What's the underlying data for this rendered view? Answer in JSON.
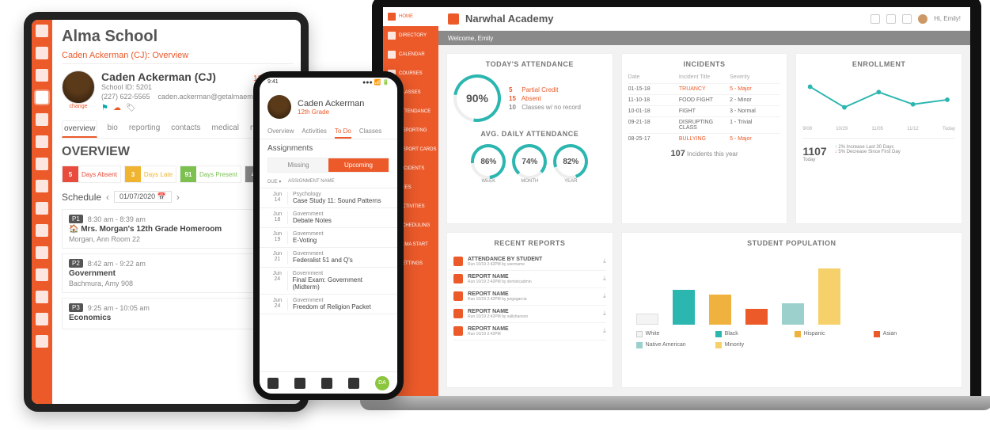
{
  "tablet": {
    "title": "Alma School",
    "breadcrumb": "Caden Ackerman (CJ): Overview",
    "change_label": "change",
    "student": {
      "name": "Caden Ackerman (CJ)",
      "id_label": "School ID: 5201",
      "grade": "12th Grade",
      "phone": "(227) 622-5565",
      "email": "caden.ackerman@getalmaemail.com"
    },
    "tabs": [
      "overview",
      "bio",
      "reporting",
      "contacts",
      "medical",
      "notes"
    ],
    "overview_heading": "OVERVIEW",
    "badges": {
      "absent_n": "5",
      "absent_l": "Days Absent",
      "late_n": "3",
      "late_l": "Days Late",
      "present_n": "91",
      "present_l": "Days Present",
      "other_n": "4",
      "other_l": "Days"
    },
    "schedule_label": "Schedule",
    "schedule_date": "01/07/2020",
    "slots": [
      {
        "pill": "P1",
        "time": "8:30 am - 8:39 am",
        "title": "🏠 Mrs. Morgan's 12th Grade Homeroom",
        "sub": "Morgan, Ann    Room 22"
      },
      {
        "pill": "P2",
        "time": "8:42 am - 9:22 am",
        "title": "Government",
        "sub": "Bachmura, Amy    908"
      },
      {
        "pill": "P3",
        "time": "9:25 am - 10:05 am",
        "title": "Economics",
        "sub": ""
      }
    ]
  },
  "phone": {
    "status_time": "9:41",
    "student_name": "Caden Ackerman",
    "grade": "12th Grade",
    "tabs": [
      "Overview",
      "Activities",
      "To Do",
      "Classes"
    ],
    "active_tab": "To Do",
    "section": "Assignments",
    "seg": [
      "Missing",
      "Upcoming"
    ],
    "active_seg": "Upcoming",
    "thead": [
      "DUE ▾",
      "ASSIGNMENT NAME"
    ],
    "rows": [
      {
        "m": "Jun",
        "d": "14",
        "s": "Psychology",
        "t": "Case Study 11: Sound Patterns"
      },
      {
        "m": "Jun",
        "d": "18",
        "s": "Government",
        "t": "Debate Notes"
      },
      {
        "m": "Jun",
        "d": "19",
        "s": "Government",
        "t": "E-Voting"
      },
      {
        "m": "Jun",
        "d": "21",
        "s": "Government",
        "t": "Federalist 51 and Q's"
      },
      {
        "m": "Jun",
        "d": "24",
        "s": "Government",
        "t": "Final Exam: Government (Midterm)"
      },
      {
        "m": "Jun",
        "d": "24",
        "s": "Government",
        "t": "Freedom of Religion Packet"
      }
    ],
    "da_badge": "DA"
  },
  "laptop": {
    "title": "Narwhal Academy",
    "welcome": "Welcome, Emily",
    "greeting": "Hi, Emily!",
    "nav": [
      "HOME",
      "DIRECTORY",
      "CALENDAR",
      "COURSES",
      "CLASSES",
      "ATTENDANCE",
      "REPORTING",
      "REPORT CARDS",
      "INCIDENTS",
      "FEES",
      "ACTIVITIES",
      "SCHEDULING",
      "ALMA START",
      "SETTINGS"
    ],
    "cards": {
      "attendance": {
        "title": "TODAY'S ATTENDANCE",
        "main_pct": "90%",
        "stats": [
          {
            "n": "5",
            "l": "Partial Credit",
            "cls": "c-or"
          },
          {
            "n": "15",
            "l": "Absent",
            "cls": "c-or"
          },
          {
            "n": "10",
            "l": "Classes w/ no record",
            "cls": ""
          }
        ],
        "avg_title": "AVG. DAILY ATTENDANCE",
        "rings": [
          {
            "v": "86%",
            "l": "WEEK"
          },
          {
            "v": "74%",
            "l": "MONTH"
          },
          {
            "v": "82%",
            "l": "YEAR"
          }
        ]
      },
      "incidents": {
        "title": "INCIDENTS",
        "headers": [
          "Date",
          "Incident Title",
          "Severity"
        ],
        "rows": [
          {
            "d": "01-15-18",
            "t": "TRUANCY",
            "s": "5 - Major",
            "hl": true
          },
          {
            "d": "11-10-18",
            "t": "FOOD FIGHT",
            "s": "2 - Minor"
          },
          {
            "d": "10-01-18",
            "t": "FIGHT",
            "s": "3 - Normal"
          },
          {
            "d": "09-21-18",
            "t": "DISRUPTING CLASS",
            "s": "1 - Trivial"
          },
          {
            "d": "08-25-17",
            "t": "BULLYING",
            "s": "5 - Major",
            "hl": true
          }
        ],
        "total_n": "107",
        "total_l": "Incidents this year"
      },
      "enrollment": {
        "title": "ENROLLMENT",
        "axis": [
          "9/08",
          "10/29",
          "11/05",
          "11/12",
          "Today"
        ],
        "big_n": "1107",
        "big_l": "Today",
        "changes": [
          {
            "dir": "up",
            "txt": "2% Increase Last 30 Days"
          },
          {
            "dir": "down",
            "txt": "5% Decrease Since First Day"
          }
        ]
      },
      "reports": {
        "title": "RECENT REPORTS",
        "rows": [
          {
            "t": "ATTENDANCE BY STUDENT",
            "s": "Run 10/19 2:42PM by username"
          },
          {
            "t": "REPORT NAME",
            "s": "Run 10/19 2:42PM by dominicadmin"
          },
          {
            "t": "REPORT NAME",
            "s": "Run 10/19 2:42PM by jorgegarcia"
          },
          {
            "t": "REPORT NAME",
            "s": "Run 10/19 2:42PM by sallyhanson"
          },
          {
            "t": "REPORT NAME",
            "s": "Run 10/19 2:42PM"
          }
        ]
      },
      "population": {
        "title": "STUDENT POPULATION",
        "legend": [
          {
            "c": "#f4f4f4",
            "l": "White"
          },
          {
            "c": "#2bb6b0",
            "l": "Black"
          },
          {
            "c": "#efb23e",
            "l": "Hispanic"
          },
          {
            "c": "#ec5a2a",
            "l": "Asian"
          },
          {
            "c": "#9bd0cd",
            "l": "Native American"
          },
          {
            "c": "#f5d06b",
            "l": "Minority"
          }
        ]
      }
    }
  },
  "chart_data": [
    {
      "type": "line",
      "title": "ENROLLMENT",
      "categories": [
        "9/08",
        "10/29",
        "11/05",
        "11/12",
        "Today"
      ],
      "values": [
        1140,
        1095,
        1120,
        1100,
        1107
      ],
      "ylim": [
        1050,
        1160
      ]
    },
    {
      "type": "bar",
      "title": "STUDENT POPULATION",
      "categories": [
        "White",
        "Black",
        "Hispanic",
        "Asian",
        "Native American",
        "Minority"
      ],
      "values": [
        15,
        48,
        42,
        22,
        30,
        78
      ],
      "colors": [
        "#f4f4f4",
        "#2bb6b0",
        "#efb23e",
        "#ec5a2a",
        "#9bd0cd",
        "#f5d06b"
      ],
      "ylim": [
        0,
        100
      ]
    }
  ]
}
